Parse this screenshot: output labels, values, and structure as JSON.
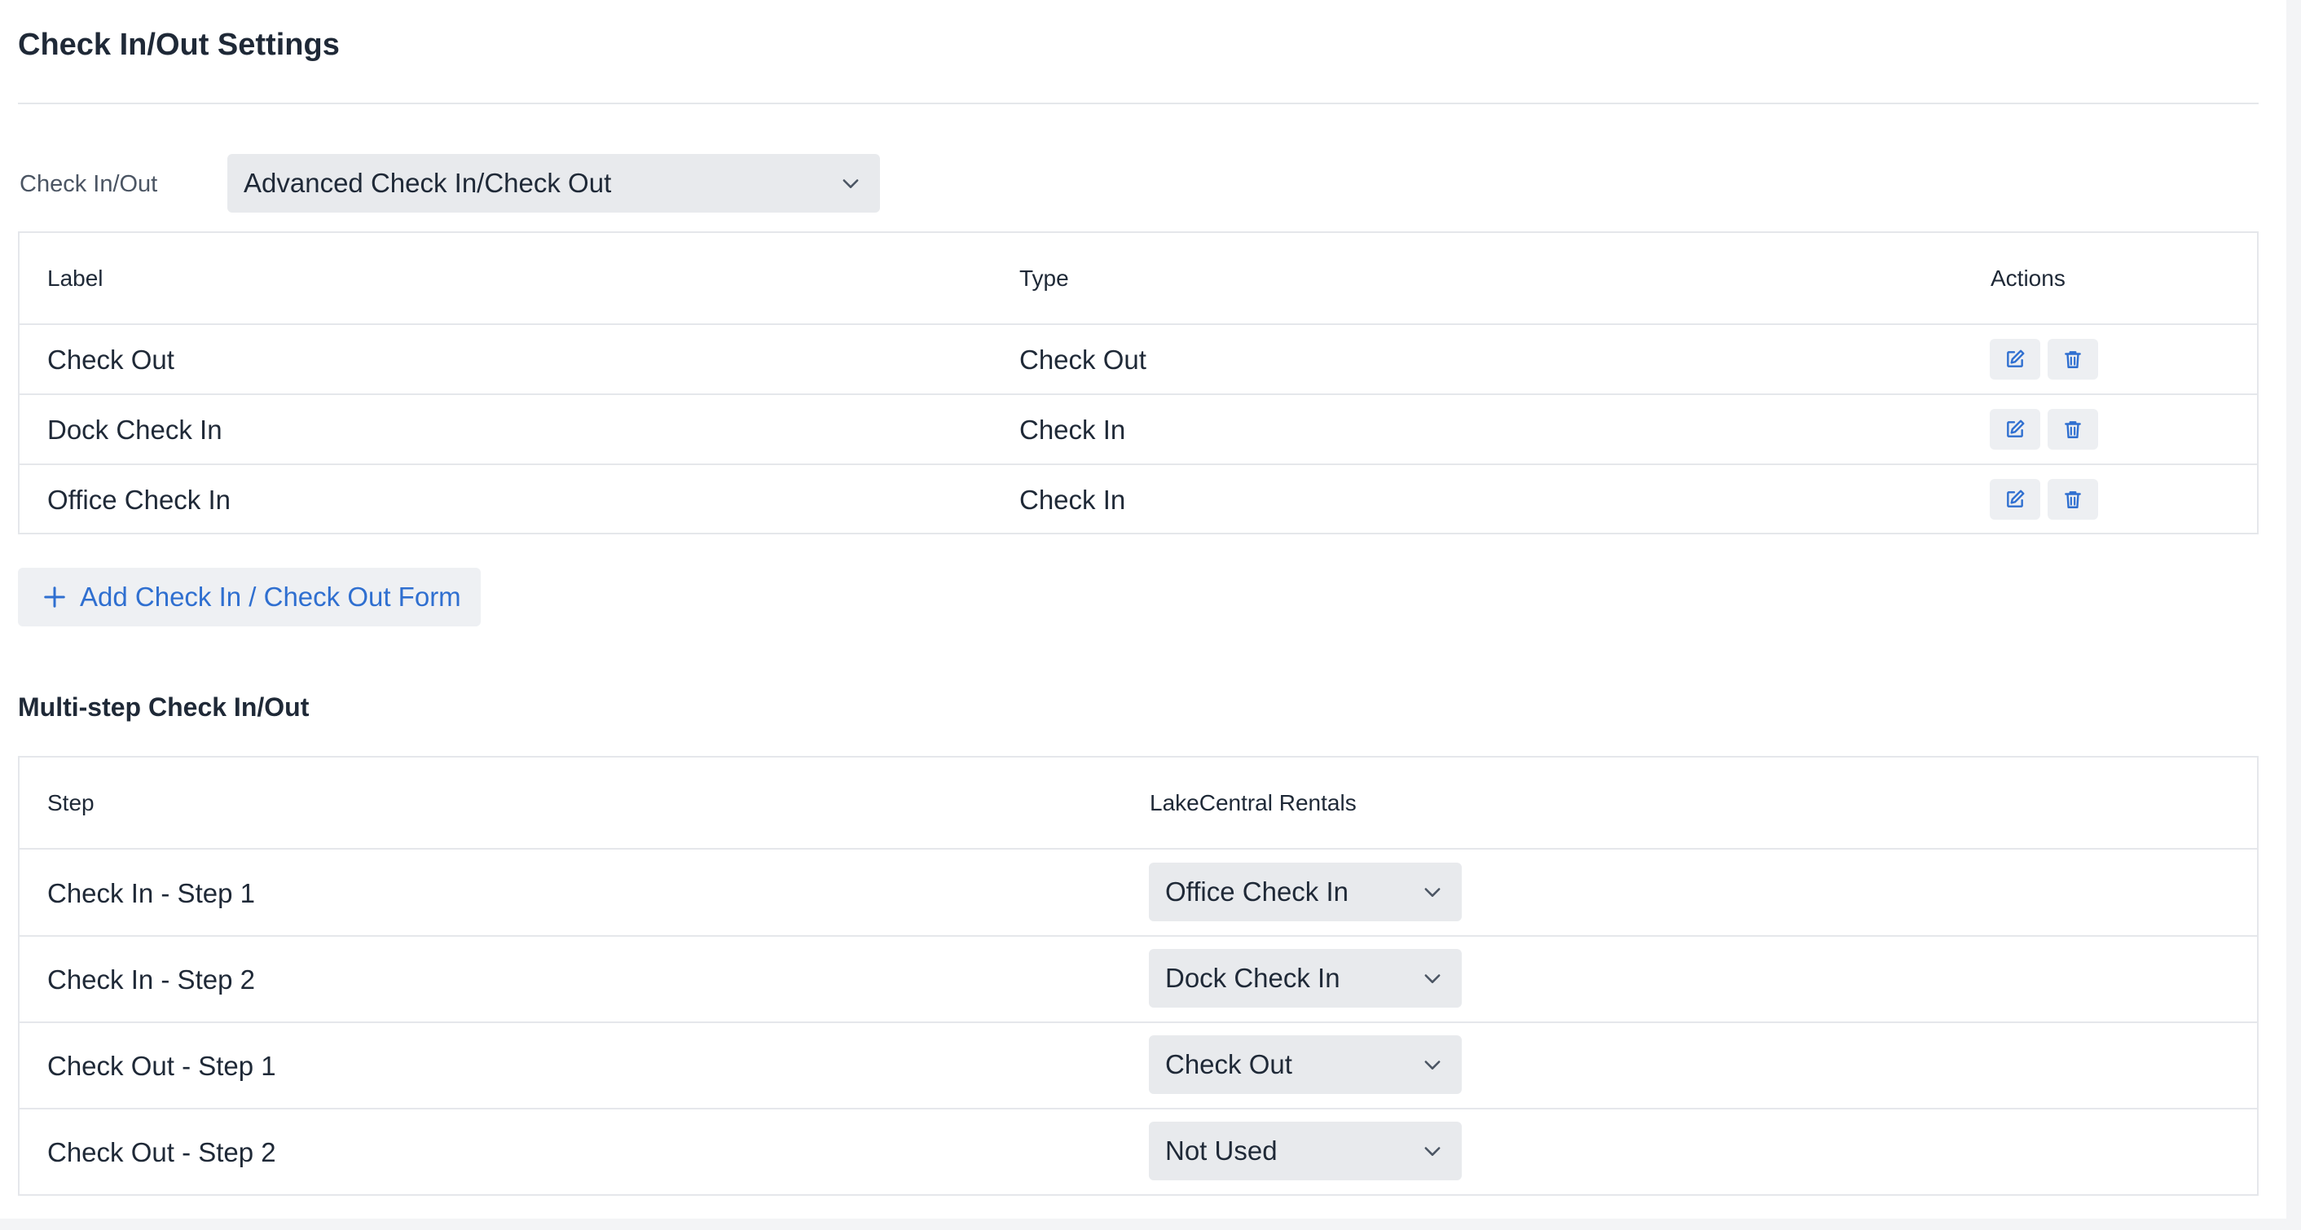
{
  "page": {
    "title": "Check In/Out Settings"
  },
  "mode": {
    "label": "Check In/Out",
    "selected": "Advanced Check In/Check Out"
  },
  "forms_table": {
    "headers": {
      "label": "Label",
      "type": "Type",
      "actions": "Actions"
    },
    "rows": [
      {
        "label": "Check Out",
        "type": "Check Out"
      },
      {
        "label": "Dock Check In",
        "type": "Check In"
      },
      {
        "label": "Office Check In",
        "type": "Check In"
      }
    ]
  },
  "add_button": {
    "label": "Add Check In / Check Out Form"
  },
  "multistep": {
    "title": "Multi-step Check In/Out",
    "headers": {
      "step": "Step",
      "location": "LakeCentral Rentals"
    },
    "rows": [
      {
        "step": "Check In - Step 1",
        "value": "Office Check In"
      },
      {
        "step": "Check In - Step 2",
        "value": "Dock Check In"
      },
      {
        "step": "Check Out - Step 1",
        "value": "Check Out"
      },
      {
        "step": "Check Out - Step 2",
        "value": "Not Used"
      }
    ]
  },
  "icons": {
    "edit": "edit-icon",
    "delete": "trash-icon",
    "add": "plus-icon",
    "dropdown": "chevron-down-icon"
  },
  "colors": {
    "accent": "#2f6fd0",
    "text": "#1f2937",
    "muted": "#4b5563",
    "border": "#e5e7eb",
    "control_bg": "#e8eaed"
  }
}
